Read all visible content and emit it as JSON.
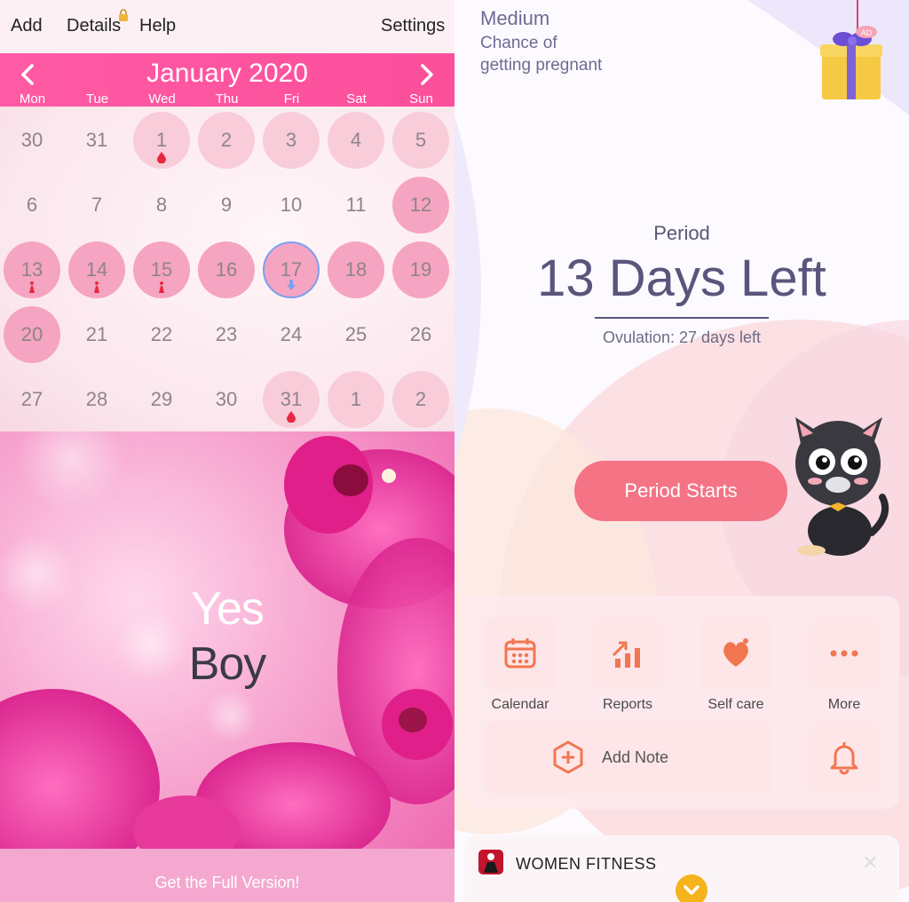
{
  "toolbar": {
    "add": "Add",
    "details": "Details",
    "help": "Help",
    "settings": "Settings"
  },
  "calendar": {
    "title": "January 2020",
    "weekdays": [
      "Mon",
      "Tue",
      "Wed",
      "Thu",
      "Fri",
      "Sat",
      "Sun"
    ],
    "accent": "#fc4f9b",
    "days": [
      {
        "label": "30",
        "style": "none"
      },
      {
        "label": "31",
        "style": "none"
      },
      {
        "label": "1",
        "style": "light",
        "marker": "drop"
      },
      {
        "label": "2",
        "style": "light"
      },
      {
        "label": "3",
        "style": "light"
      },
      {
        "label": "4",
        "style": "light"
      },
      {
        "label": "5",
        "style": "light"
      },
      {
        "label": "6",
        "style": "none"
      },
      {
        "label": "7",
        "style": "none"
      },
      {
        "label": "8",
        "style": "none"
      },
      {
        "label": "9",
        "style": "none"
      },
      {
        "label": "10",
        "style": "none"
      },
      {
        "label": "11",
        "style": "none"
      },
      {
        "label": "12",
        "style": "med"
      },
      {
        "label": "13",
        "style": "med",
        "marker": "figure"
      },
      {
        "label": "14",
        "style": "med",
        "marker": "figure"
      },
      {
        "label": "15",
        "style": "med",
        "marker": "figure"
      },
      {
        "label": "16",
        "style": "med"
      },
      {
        "label": "17",
        "style": "med",
        "selected": true,
        "marker": "arrow"
      },
      {
        "label": "18",
        "style": "med"
      },
      {
        "label": "19",
        "style": "med"
      },
      {
        "label": "20",
        "style": "med"
      },
      {
        "label": "21",
        "style": "none"
      },
      {
        "label": "22",
        "style": "none"
      },
      {
        "label": "23",
        "style": "none"
      },
      {
        "label": "24",
        "style": "none"
      },
      {
        "label": "25",
        "style": "none"
      },
      {
        "label": "26",
        "style": "none"
      },
      {
        "label": "27",
        "style": "none"
      },
      {
        "label": "28",
        "style": "none"
      },
      {
        "label": "29",
        "style": "none"
      },
      {
        "label": "30",
        "style": "none"
      },
      {
        "label": "31",
        "style": "light",
        "marker": "drop"
      },
      {
        "label": "1",
        "style": "light"
      },
      {
        "label": "2",
        "style": "light"
      }
    ]
  },
  "hero": {
    "line1": "Yes",
    "line2": "Boy"
  },
  "footer": {
    "full_version": "Get the Full Version!"
  },
  "status": {
    "chance_level": "Medium",
    "chance_line1": "Chance of",
    "chance_line2": "getting pregnant",
    "period_label": "Period",
    "days_left": "13 Days Left",
    "ovulation": "Ovulation: 27 days left",
    "period_button": "Period Starts",
    "gift_badge": "AD"
  },
  "tools": {
    "calendar": "Calendar",
    "reports": "Reports",
    "selfcare": "Self care",
    "more": "More",
    "add_note": "Add Note",
    "icon_color": "#f1764f"
  },
  "ad": {
    "title": "WOMEN FITNESS",
    "close": "✕"
  }
}
